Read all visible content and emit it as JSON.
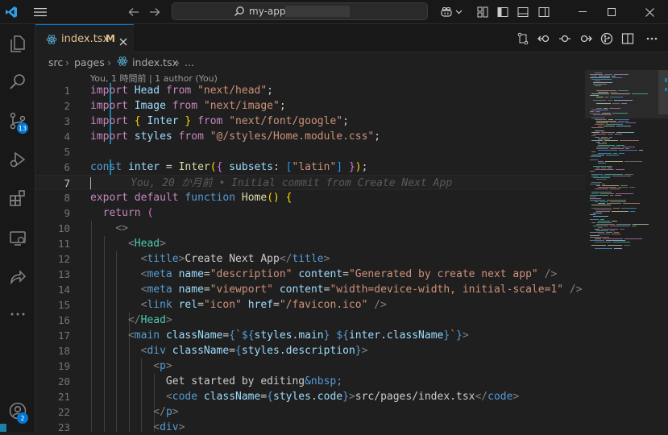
{
  "titlebar": {
    "search_text": "my-app",
    "icons": [
      "vscode-logo",
      "menu-icon",
      "back-arrow-icon",
      "forward-arrow-icon",
      "search-icon",
      "copilot-icon",
      "chevron-down-icon",
      "customize-layout-icon",
      "toggle-primary-sidebar-icon",
      "toggle-panel-icon",
      "toggle-secondary-sidebar-icon",
      "minimize-icon",
      "maximize-icon",
      "close-icon"
    ]
  },
  "activity_bar": {
    "items": [
      {
        "name": "explorer-icon"
      },
      {
        "name": "search-icon"
      },
      {
        "name": "source-control-icon",
        "badge": "13"
      },
      {
        "name": "run-debug-icon"
      },
      {
        "name": "extensions-icon"
      },
      {
        "name": "remote-explorer-icon"
      },
      {
        "name": "live-share-icon"
      },
      {
        "name": "more-icon"
      }
    ],
    "account_badge": "2"
  },
  "tab": {
    "label": "index.tsx",
    "status": "M",
    "icons": [
      "react-file-icon",
      "close-icon"
    ]
  },
  "editor_actions": [
    "open-changes-icon",
    "previous-change-icon",
    "git-commit-icon",
    "next-change-icon",
    "git-lens-icon",
    "split-editor-icon",
    "more-actions-icon"
  ],
  "breadcrumb": {
    "items": [
      "src",
      "pages",
      "index.tsx",
      "..."
    ]
  },
  "codelens": "You, 1 時間前 | 1 author (You)",
  "ghost_blame": "You, 20 か月前 • Initial commit from Create Next App",
  "code_lines": [
    "import Head from \"next/head\";",
    "import Image from \"next/image\";",
    "import { Inter } from \"next/font/google\";",
    "import styles from \"@/styles/Home.module.css\";",
    "",
    "const inter = Inter({ subsets: [\"latin\"] });",
    "",
    "export default function Home() {",
    "  return (",
    "    <>",
    "      <Head>",
    "        <title>Create Next App</title>",
    "        <meta name=\"description\" content=\"Generated by create next app\" />",
    "        <meta name=\"viewport\" content=\"width=device-width, initial-scale=1\" />",
    "        <link rel=\"icon\" href=\"/favicon.ico\" />",
    "      </Head>",
    "      <main className={`${styles.main} ${inter.className}`}>",
    "        <div className={styles.description}>",
    "          <p>",
    "            Get started by editing&nbsp;",
    "            <code className={styles.code}>src/pages/index.tsx</code>",
    "          </p>",
    "          <div>"
  ],
  "line_numbers": [
    "1",
    "2",
    "3",
    "4",
    "5",
    "6",
    "7",
    "8",
    "9",
    "10",
    "11",
    "12",
    "13",
    "14",
    "15",
    "16",
    "17",
    "18",
    "19",
    "20",
    "21",
    "22",
    "23"
  ],
  "active_line": 7
}
